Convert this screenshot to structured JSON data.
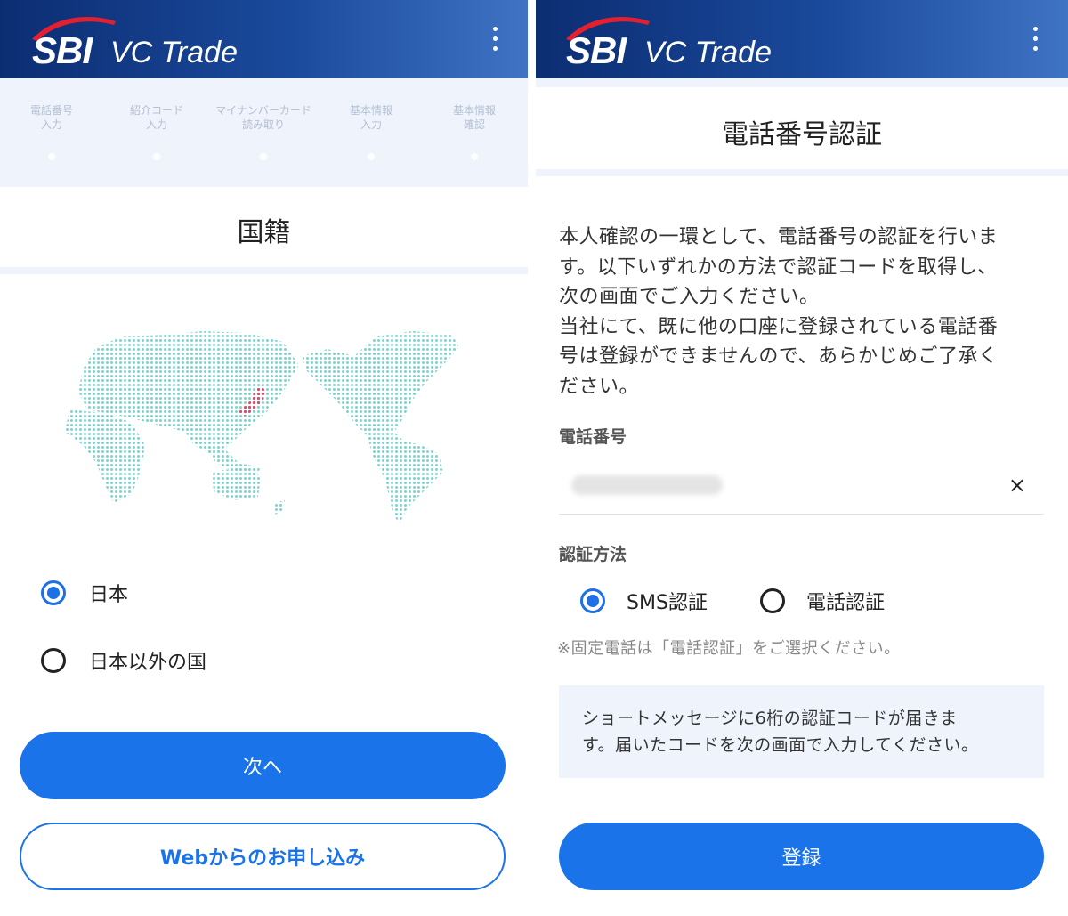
{
  "brand": {
    "logo_main": "SBI",
    "logo_sub": "VC Trade",
    "accent": "#1a73e8",
    "header_dark": "#0c2d72",
    "swoosh": "#e3202f"
  },
  "left": {
    "steps": [
      {
        "label": "電話番号\n入力"
      },
      {
        "label": "紹介コード\n入力"
      },
      {
        "label": "マイナンバーカード\n読み取り"
      },
      {
        "label": "基本情報\n入力"
      },
      {
        "label": "基本情報\n確認"
      }
    ],
    "title": "国籍",
    "nationality_options": [
      {
        "label": "日本",
        "selected": true
      },
      {
        "label": "日本以外の国",
        "selected": false
      }
    ],
    "next_button": "次へ",
    "web_button": "Webからのお申し込み",
    "icons": {
      "menu": "kebab-icon",
      "map": "world-map"
    }
  },
  "right": {
    "title": "電話番号認証",
    "description": [
      "本人確認の一環として、電話番号の認証を行いま",
      "す。以下いずれかの方法で認証コードを取得し、",
      "次の画面でご入力ください。",
      "当社にて、既に他の口座に登録されている電話番",
      "号は登録ができませんので、あらかじめご了承く",
      "ださい。"
    ],
    "phone_label": "電話番号",
    "clear_symbol": "×",
    "method_label": "認証方法",
    "methods": [
      {
        "label": "SMS認証",
        "selected": true
      },
      {
        "label": "電話認証",
        "selected": false
      }
    ],
    "note": "※固定電話は「電話認証」をご選択ください。",
    "info": [
      "ショートメッセージに6桁の認証コードが届きま",
      "す。届いたコードを次の画面で入力してください。"
    ],
    "submit_button": "登録"
  }
}
